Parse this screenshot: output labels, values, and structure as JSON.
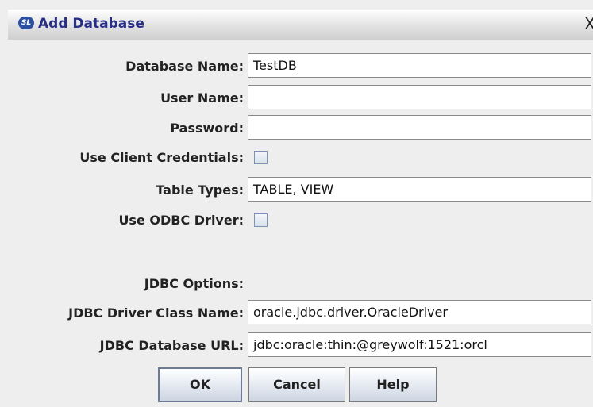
{
  "window": {
    "title": "Add Database",
    "app_icon_text": "SL",
    "close_glyph": "X"
  },
  "form": {
    "database_name": {
      "label": "Database Name:",
      "value": "TestDB"
    },
    "user_name": {
      "label": "User Name:",
      "value": ""
    },
    "password": {
      "label": "Password:",
      "value": ""
    },
    "use_client_credentials": {
      "label": "Use Client Credentials:",
      "checked": false
    },
    "table_types": {
      "label": "Table Types:",
      "value": "TABLE, VIEW"
    },
    "use_odbc_driver": {
      "label": "Use ODBC Driver:",
      "checked": false
    },
    "jdbc_options": {
      "label": "JDBC Options:"
    },
    "jdbc_driver_class_name": {
      "label": "JDBC Driver Class Name:",
      "value": "oracle.jdbc.driver.OracleDriver"
    },
    "jdbc_database_url": {
      "label": "JDBC Database URL:",
      "value": "jdbc:oracle:thin:@greywolf:1521:orcl"
    }
  },
  "buttons": {
    "ok": "OK",
    "cancel": "Cancel",
    "help": "Help"
  }
}
